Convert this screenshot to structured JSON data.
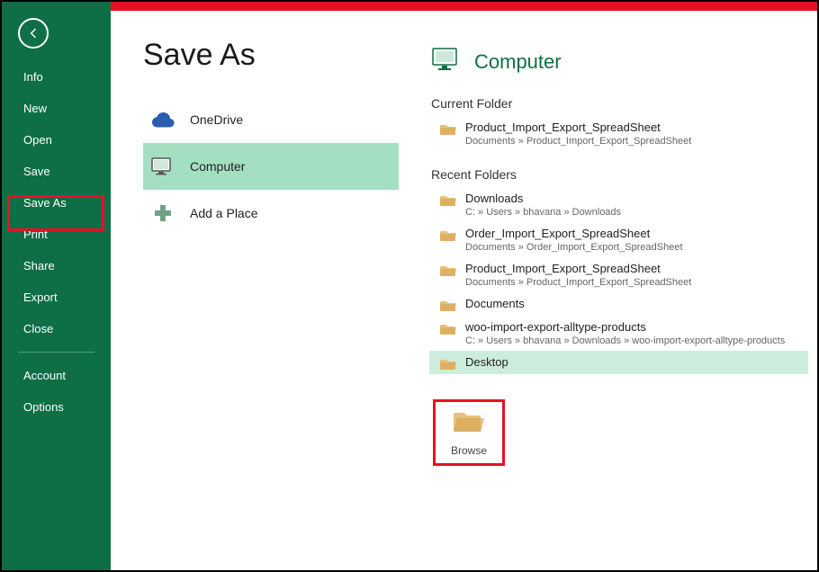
{
  "sidebar": {
    "items": [
      {
        "label": "Info"
      },
      {
        "label": "New"
      },
      {
        "label": "Open"
      },
      {
        "label": "Save"
      },
      {
        "label": "Save As"
      },
      {
        "label": "Print"
      },
      {
        "label": "Share"
      },
      {
        "label": "Export"
      },
      {
        "label": "Close"
      }
    ],
    "footer": [
      {
        "label": "Account"
      },
      {
        "label": "Options"
      }
    ]
  },
  "page": {
    "title": "Save As"
  },
  "locations": {
    "items": [
      {
        "label": "OneDrive"
      },
      {
        "label": "Computer"
      },
      {
        "label": "Add a Place"
      }
    ]
  },
  "right": {
    "title": "Computer",
    "current_folder_label": "Current Folder",
    "current_folder": {
      "name": "Product_Import_Export_SpreadSheet",
      "path": "Documents » Product_Import_Export_SpreadSheet"
    },
    "recent_folders_label": "Recent Folders",
    "recent_folders": [
      {
        "name": "Downloads",
        "path": "C: » Users » bhavana » Downloads"
      },
      {
        "name": "Order_Import_Export_SpreadSheet",
        "path": "Documents » Order_Import_Export_SpreadSheet"
      },
      {
        "name": "Product_Import_Export_SpreadSheet",
        "path": "Documents » Product_Import_Export_SpreadSheet"
      },
      {
        "name": "Documents",
        "path": ""
      },
      {
        "name": "woo-import-export-alltype-products",
        "path": "C: » Users » bhavana » Downloads » woo-import-export-alltype-products"
      },
      {
        "name": "Desktop",
        "path": ""
      }
    ],
    "browse_label": "Browse"
  }
}
